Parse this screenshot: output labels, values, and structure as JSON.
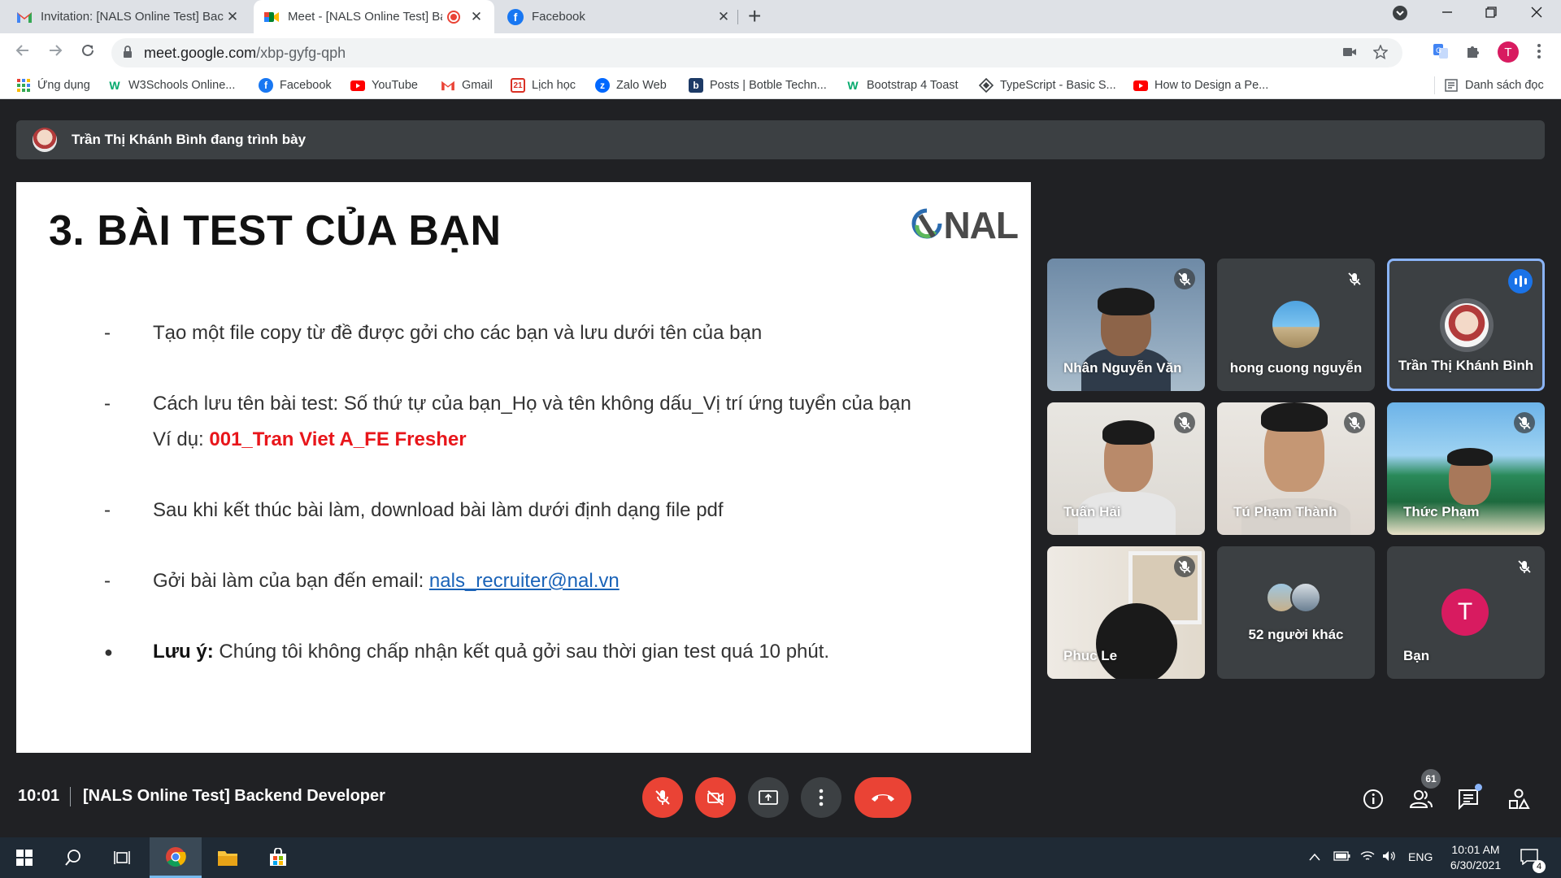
{
  "browser": {
    "tabs": [
      {
        "title": "Invitation: [NALS Online Test] Bac",
        "favicon": "gmail-icon",
        "active": false
      },
      {
        "title": "Meet - [NALS Online Test] Ba",
        "favicon": "meet-icon",
        "active": true,
        "recording": true
      },
      {
        "title": "Facebook",
        "favicon": "facebook-icon",
        "active": false
      }
    ],
    "tab_close_glyph": "✕",
    "new_tab_glyph": "+",
    "address": {
      "host": "meet.google.com",
      "path": "/xbp-gyfg-qph"
    },
    "profile_initial": "T",
    "bookmarks": [
      {
        "label": "Ứng dụng",
        "icon": "apps-grid-icon"
      },
      {
        "label": "W3Schools Online...",
        "icon": "w3schools-icon"
      },
      {
        "label": "Facebook",
        "icon": "facebook-icon"
      },
      {
        "label": "YouTube",
        "icon": "youtube-icon"
      },
      {
        "label": "Gmail",
        "icon": "gmail-icon"
      },
      {
        "label": "Lịch học",
        "icon": "calendar-icon"
      },
      {
        "label": "Zalo Web",
        "icon": "zalo-icon"
      },
      {
        "label": "Posts | Botble Techn...",
        "icon": "botble-icon"
      },
      {
        "label": "Bootstrap 4 Toast",
        "icon": "w3schools-icon"
      },
      {
        "label": "TypeScript - Basic S...",
        "icon": "typescript-icon"
      },
      {
        "label": "How to Design a Pe...",
        "icon": "youtube-icon"
      }
    ],
    "reading_list": "Danh sách đọc"
  },
  "meet": {
    "presenter_text": "Trần Thị Khánh Bình đang trình bày",
    "slide": {
      "title": "3. BÀI TEST CỦA BẠN",
      "logo_text": "NAL",
      "dash": "-",
      "dot": "●",
      "bullet1": "Tạo một file copy từ đề được gởi cho các bạn và lưu dưới tên của bạn",
      "bullet2_line1": "Cách lưu tên bài test: Số thứ tự của bạn_Họ và tên không dấu_Vị trí ứng tuyển của bạn",
      "bullet2_line2_prefix": "Ví dụ: ",
      "bullet2_example": "001_Tran Viet A_FE Fresher",
      "bullet3": "Sau khi kết thúc bài làm, download bài làm dưới định dạng file pdf",
      "bullet4_prefix": "Gởi bài làm của bạn đến email: ",
      "bullet4_email": "nals_recruiter@nal.vn",
      "note_label": "Lưu ý:",
      "note_text": " Chúng tôi không chấp nhận kết quả gởi sau thời gian test quá 10 phút."
    },
    "participants": [
      {
        "name": "Nhân Nguyễn Văn",
        "muted": true
      },
      {
        "name": "hong cuong nguyễn",
        "muted": true
      },
      {
        "name": "Trần Thị Khánh Bình",
        "speaking": true
      },
      {
        "name": "Tuấn Hải",
        "muted": true
      },
      {
        "name": "Tú Phạm Thành",
        "muted": true
      },
      {
        "name": "Thức Phạm",
        "muted": true
      },
      {
        "name": "Phuc Le",
        "muted": true
      },
      {
        "name": "52 người khác"
      },
      {
        "name": "Bạn",
        "muted": true,
        "initial": "T"
      }
    ],
    "time": "10:01",
    "meeting_title": "[NALS Online Test] Backend Developer",
    "people_count": "61"
  },
  "taskbar": {
    "language": "ENG",
    "time": "10:01 AM",
    "date": "6/30/2021",
    "notifications": "4"
  },
  "colors": {
    "meet_bg": "#202124",
    "tile_bg": "#3c4043",
    "red_button": "#ea4335",
    "active_speaker": "#8ab4f8",
    "slide_red": "#e8161b"
  }
}
